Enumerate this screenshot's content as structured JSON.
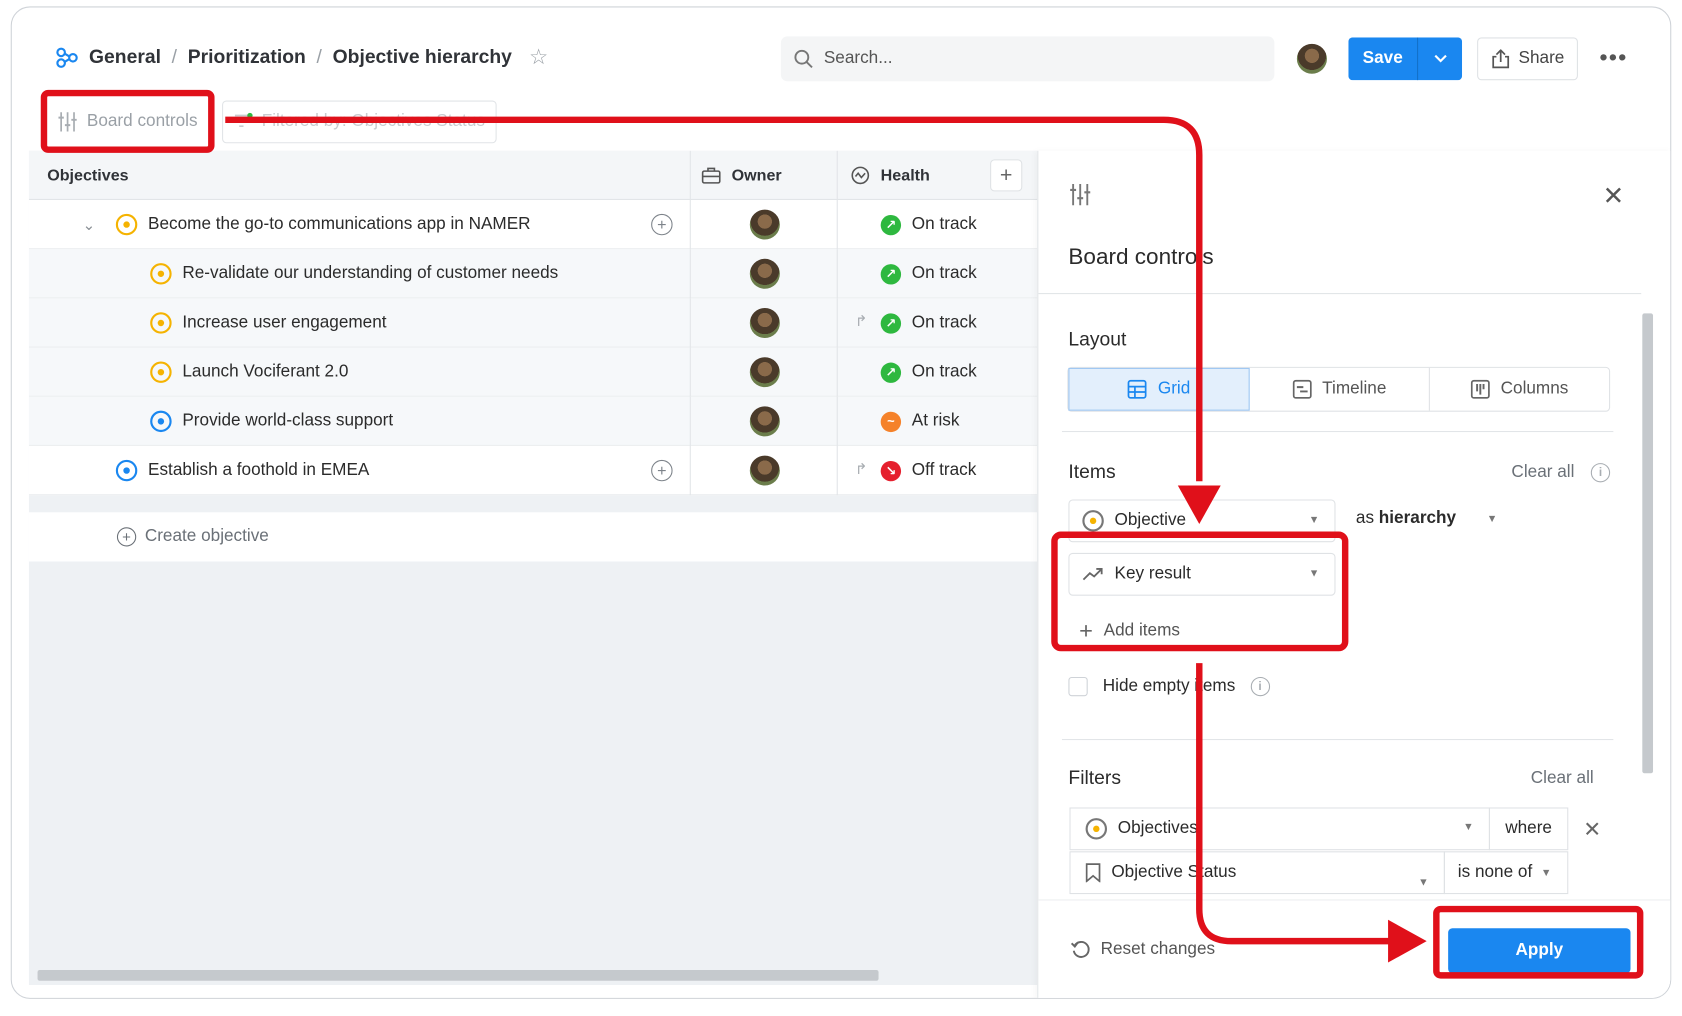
{
  "breadcrumb": {
    "items": [
      "General",
      "Prioritization",
      "Objective hierarchy"
    ],
    "separator": "/"
  },
  "search": {
    "placeholder": "Search..."
  },
  "header": {
    "save_label": "Save",
    "share_label": "Share",
    "more_label": "•••"
  },
  "toolbar": {
    "board_controls_label": "Board controls",
    "filter_chip_label": "Filtered by: Objectives Status"
  },
  "grid": {
    "columns": {
      "objectives": "Objectives",
      "owner": "Owner",
      "health": "Health"
    },
    "rows": [
      {
        "name": "Become the go-to communications app in NAMER",
        "status": "On track"
      },
      {
        "name": "Re-validate our understanding of customer needs",
        "status": "On track"
      },
      {
        "name": "Increase user engagement",
        "status": "On track"
      },
      {
        "name": "Launch Vociferant 2.0",
        "status": "On track"
      },
      {
        "name": "Provide world-class support",
        "status": "At risk"
      },
      {
        "name": "Establish a foothold in EMEA",
        "status": "Off track"
      }
    ],
    "create_label": "Create objective"
  },
  "panel": {
    "title": "Board controls",
    "layout": {
      "heading": "Layout",
      "options": [
        "Grid",
        "Timeline",
        "Columns"
      ],
      "selected": "Grid"
    },
    "items": {
      "heading": "Items",
      "clear_all": "Clear all",
      "item1": "Objective",
      "as_prefix": "as",
      "as_value": "hierarchy",
      "item2": "Key result",
      "add_items": "Add items",
      "hide_empty": "Hide empty items"
    },
    "filters": {
      "heading": "Filters",
      "clear_all": "Clear all",
      "field": "Objectives",
      "where": "where",
      "sub_field": "Objective Status",
      "operator": "is none of"
    },
    "reset_label": "Reset changes",
    "apply_label": "Apply"
  },
  "colors": {
    "accent": "#1a87f0",
    "on_track": "#2eb83f",
    "at_risk": "#f5822a",
    "off_track": "#e5202e",
    "annotation": "#e0101a"
  }
}
